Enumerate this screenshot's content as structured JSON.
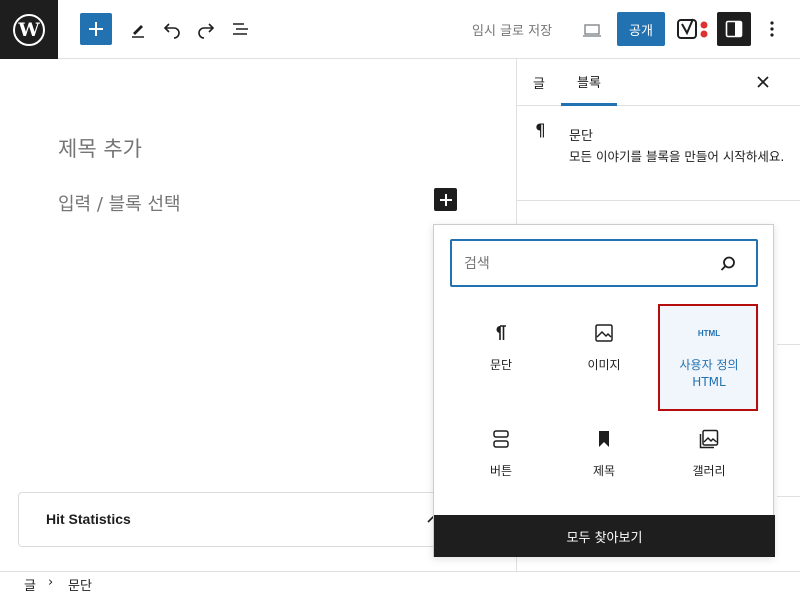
{
  "toolbar": {
    "logo_letter": "W",
    "save_draft": "임시 글로 저장",
    "publish": "공개"
  },
  "editor": {
    "title_placeholder": "제목 추가",
    "paragraph_placeholder": "입력 / 블록 선택",
    "meta_box_title": "Hit Statistics"
  },
  "sidebar": {
    "tabs": [
      {
        "label": "글"
      },
      {
        "label": "블록"
      }
    ],
    "block_card": {
      "icon": "¶",
      "name": "문단",
      "description": "모든 이야기를 블록을 만들어 시작하세요."
    }
  },
  "inserter": {
    "search_placeholder": "검색",
    "blocks": [
      {
        "label": "문단",
        "icon": "paragraph-icon"
      },
      {
        "label": "이미지",
        "icon": "image-icon"
      },
      {
        "label": "사용자 정의 HTML",
        "icon": "html-icon",
        "icon_text": "HTML",
        "highlighted": true
      },
      {
        "label": "버튼",
        "icon": "buttons-icon"
      },
      {
        "label": "제목",
        "icon": "bookmark-icon"
      },
      {
        "label": "갤러리",
        "icon": "gallery-icon"
      }
    ],
    "browse_all": "모두 찾아보기"
  },
  "breadcrumb": {
    "items": [
      "글",
      "문단"
    ],
    "separator": "›"
  },
  "colors": {
    "accent": "#2271b1",
    "dark": "#1e1e1e",
    "highlight_border": "#b50d0d"
  }
}
